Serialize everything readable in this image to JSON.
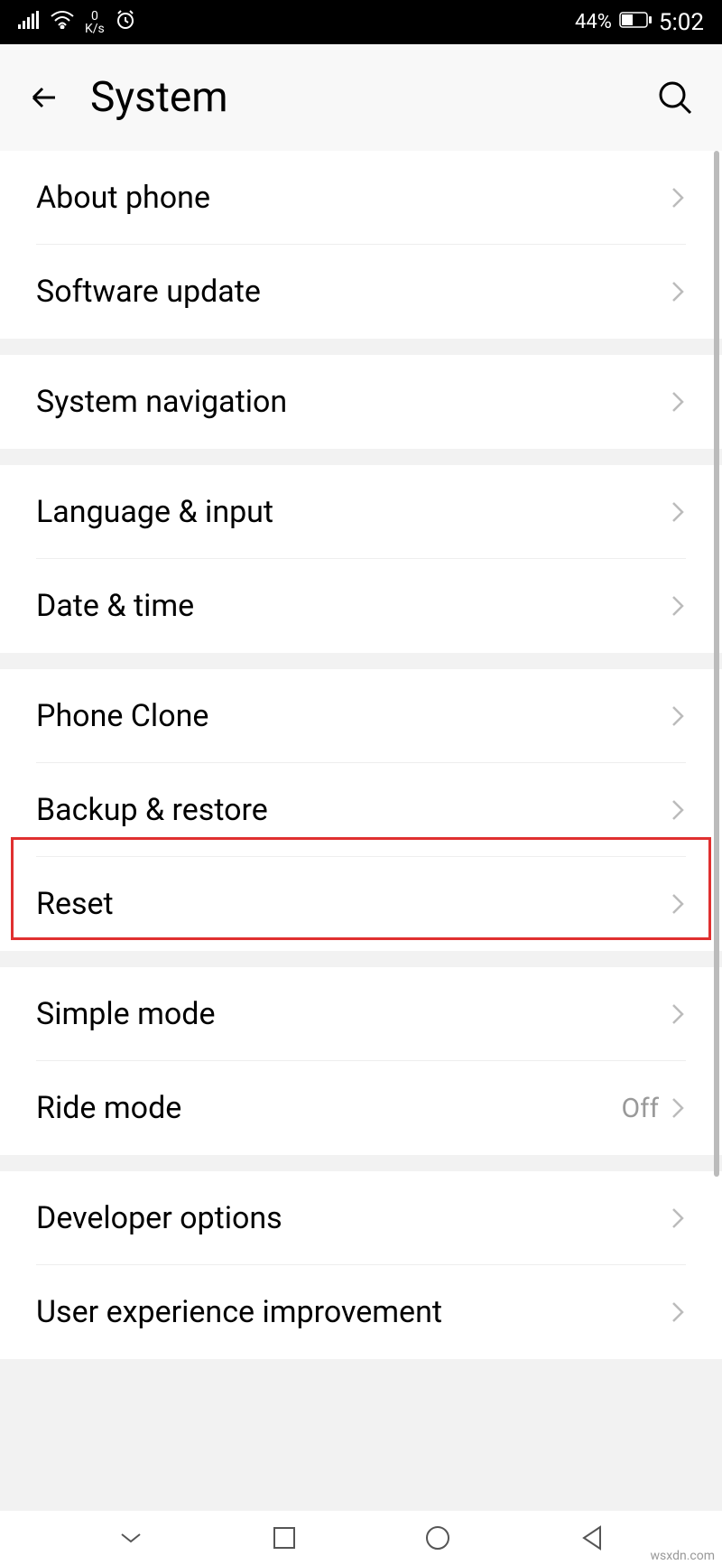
{
  "status": {
    "speed_top": "0",
    "speed_unit": "K/s",
    "battery_pct": "44%",
    "time": "5:02"
  },
  "header": {
    "title": "System"
  },
  "sections": [
    {
      "items": [
        {
          "label": "About phone"
        },
        {
          "label": "Software update"
        }
      ]
    },
    {
      "items": [
        {
          "label": "System navigation"
        }
      ]
    },
    {
      "items": [
        {
          "label": "Language & input"
        },
        {
          "label": "Date & time"
        }
      ]
    },
    {
      "items": [
        {
          "label": "Phone Clone"
        },
        {
          "label": "Backup & restore"
        },
        {
          "label": "Reset"
        }
      ]
    },
    {
      "items": [
        {
          "label": "Simple mode"
        },
        {
          "label": "Ride mode",
          "value": "Off"
        }
      ]
    },
    {
      "items": [
        {
          "label": "Developer options"
        },
        {
          "label": "User experience improvement"
        }
      ]
    }
  ],
  "watermark": "wsxdn.com"
}
